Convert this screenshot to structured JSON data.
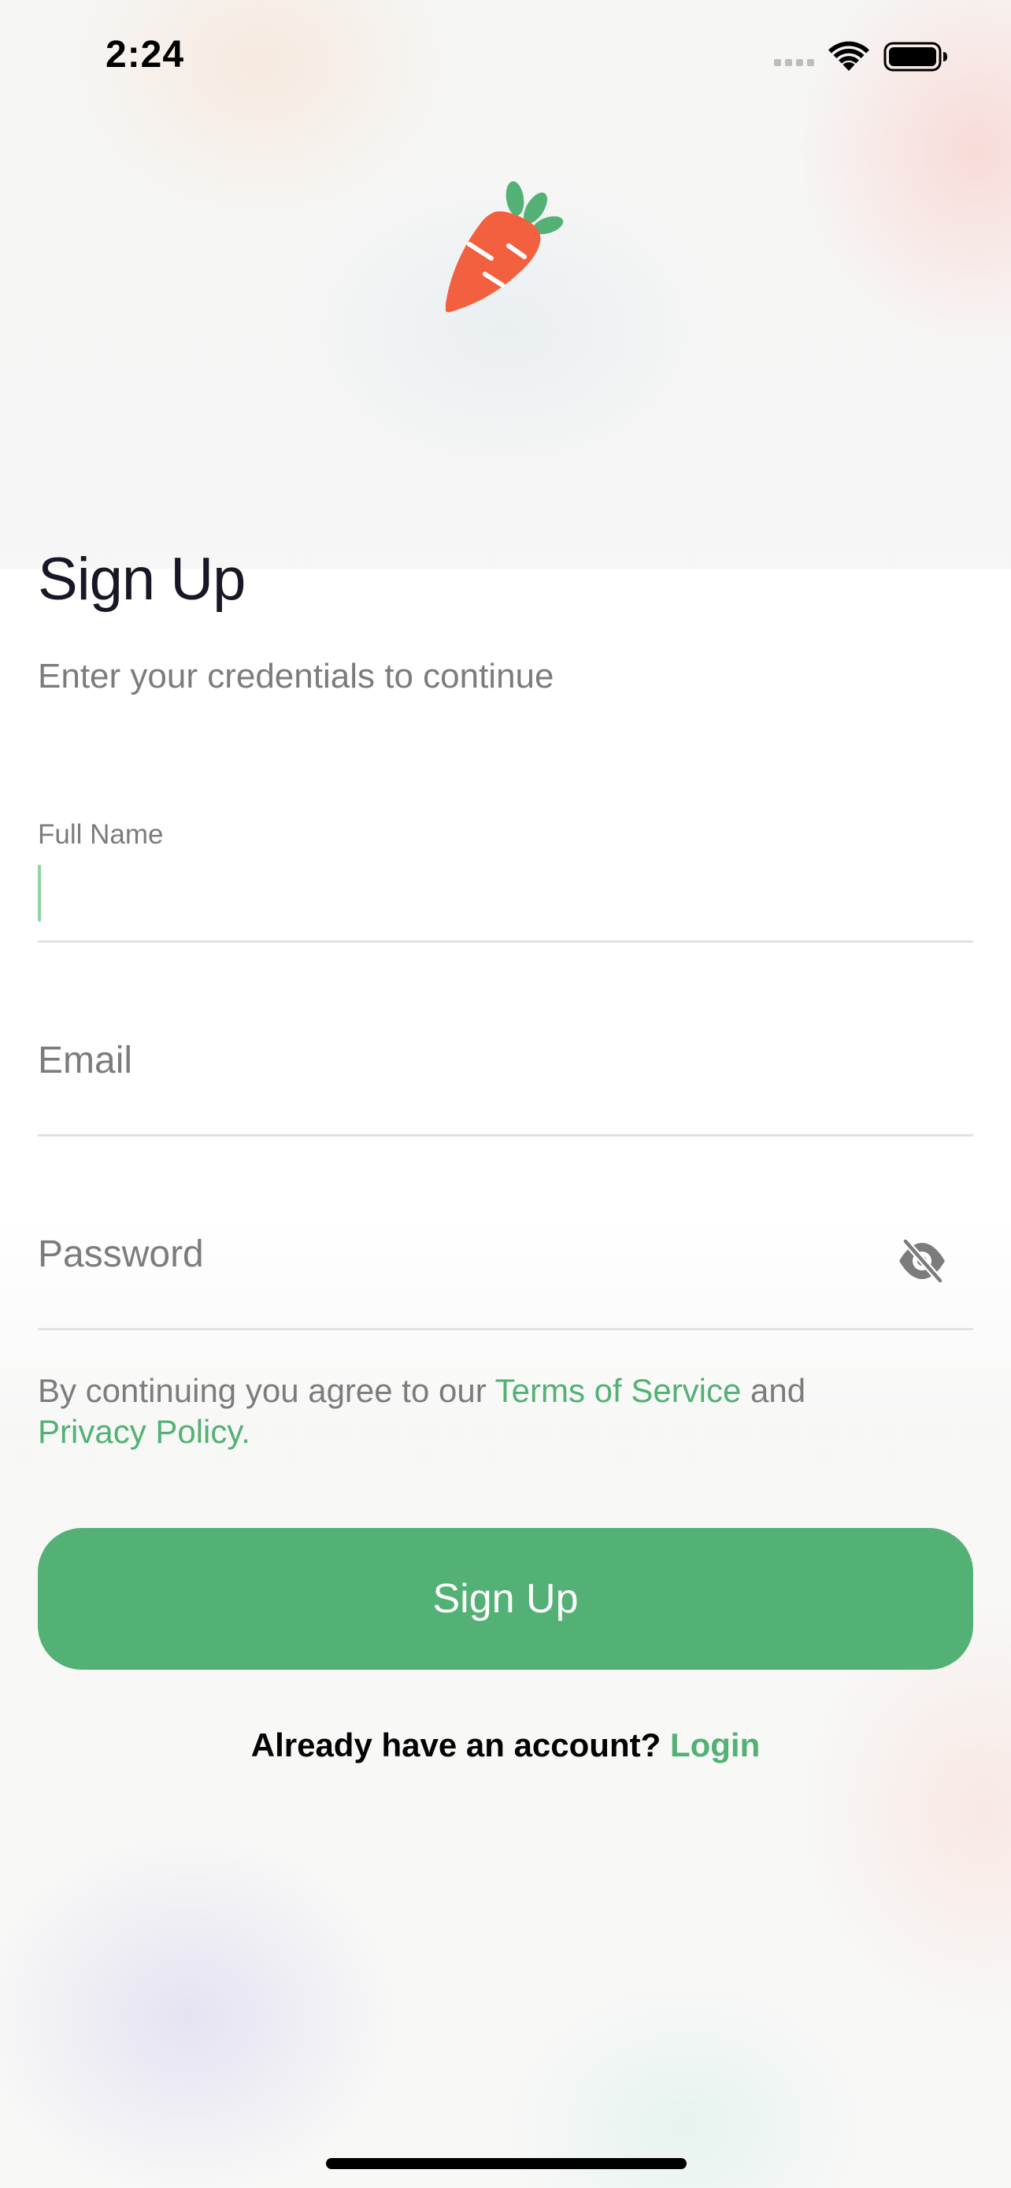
{
  "status_bar": {
    "time": "2:24"
  },
  "form": {
    "title": "Sign Up",
    "subtitle": "Enter your credentials to continue",
    "full_name": {
      "label": "Full Name",
      "value": ""
    },
    "email": {
      "placeholder": "Email"
    },
    "password": {
      "placeholder": "Password"
    }
  },
  "terms": {
    "prefix": "By continuing you agree to our ",
    "terms_link": "Terms of Service",
    "middle": " and ",
    "privacy_link": "Privacy Policy."
  },
  "signup_button": "Sign Up",
  "login": {
    "prompt": "Already have an account? ",
    "link": "Login"
  },
  "colors": {
    "accent": "#53b175",
    "logo": "#f3603f",
    "text": "#181725",
    "muted": "#7c7c7c"
  },
  "icons": [
    "signal-icon",
    "wifi-icon",
    "battery-icon",
    "carrot-logo-icon",
    "eye-off-icon"
  ]
}
